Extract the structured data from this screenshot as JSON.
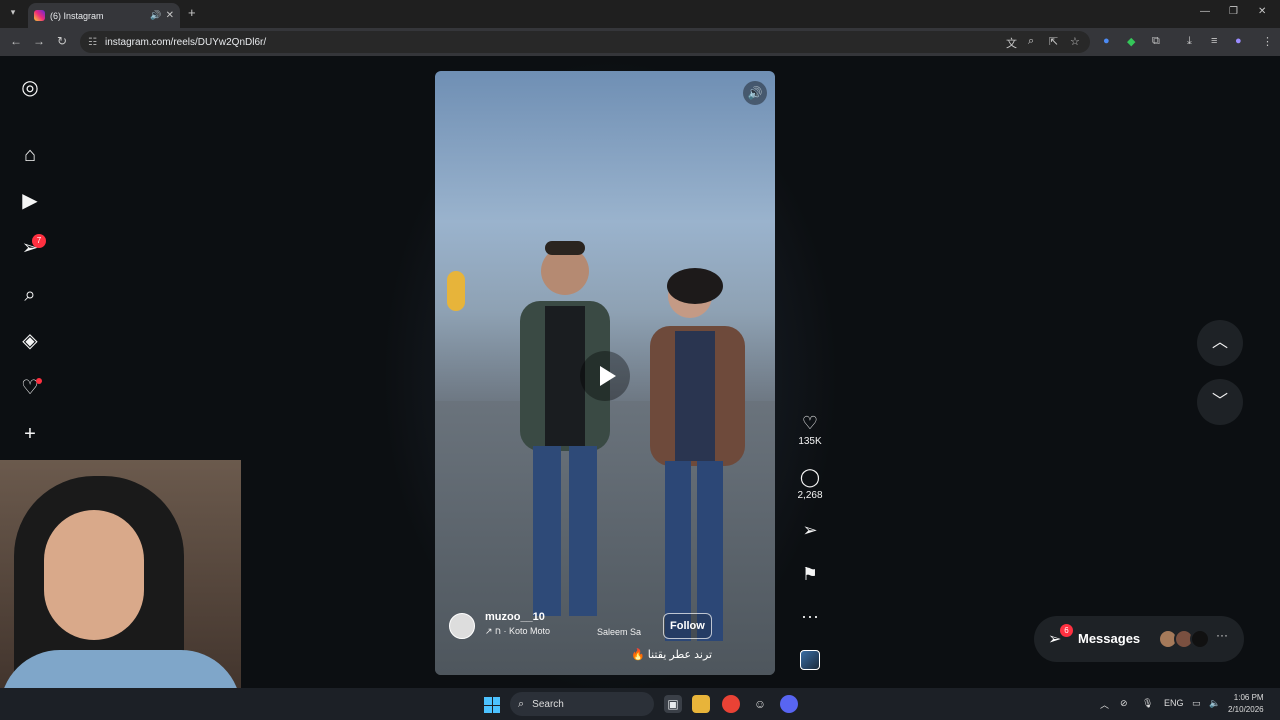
{
  "browser": {
    "tab_title": "(6) Instagram",
    "new_tab": "+",
    "url": "instagram.com/reels/DUYw2QnDl6r/"
  },
  "sidebar": {
    "notifications_count": "7"
  },
  "reel": {
    "username": "muzoo__10",
    "music": "↗ ח · Koto Moto",
    "second_author": "Saleem Sa",
    "follow_label": "Follow",
    "caption": "ترند عطر يقتنا 🔥",
    "likes": "135K",
    "comments": "2,268"
  },
  "messages": {
    "label": "Messages",
    "badge": "6"
  },
  "taskbar": {
    "search_placeholder": "Search",
    "lang": "ENG",
    "time": "1:06 PM",
    "date": "2/10/2026"
  },
  "colors": {
    "accent_badge": "#ff3040",
    "background": "#0c0f12"
  }
}
